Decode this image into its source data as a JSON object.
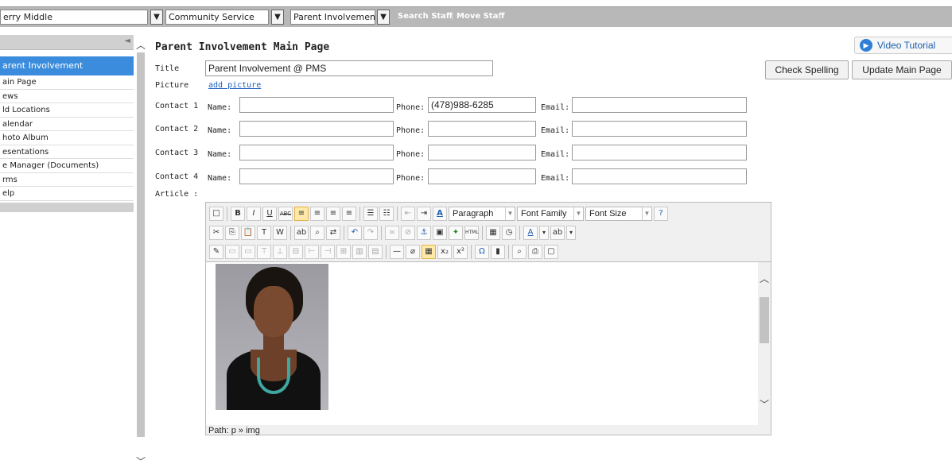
{
  "topbar": {
    "school_select": "erry Middle",
    "section_select": "Community Service",
    "page_select": "Parent Involvement",
    "search_staff": "Search Staff",
    "move_staff": "Move Staff",
    "separator": "|"
  },
  "sidebar": {
    "collapse_glyph": "◄",
    "active": "arent Involvement",
    "items": [
      "ain Page",
      "ews",
      "ld Locations",
      "alendar",
      "hoto Album",
      "esentations",
      "e Manager (Documents)",
      "rms",
      "elp"
    ]
  },
  "main": {
    "title": "Parent Involvement Main Page",
    "video_tutorial": "Video Tutorial",
    "check_spelling": "Check Spelling",
    "update_main_page": "Update Main Page",
    "title_label": "Title",
    "title_value": "Parent Involvement @ PMS",
    "picture_label": "Picture",
    "add_picture": "add picture",
    "name_label": "Name:",
    "phone_label": "Phone:",
    "email_label": "Email:",
    "article_label": "Article :",
    "contacts": [
      {
        "label": "Contact 1",
        "name": "",
        "phone": "(478)988-6285",
        "email": ""
      },
      {
        "label": "Contact 2",
        "name": "",
        "phone": "",
        "email": ""
      },
      {
        "label": "Contact 3",
        "name": "",
        "phone": "",
        "email": ""
      },
      {
        "label": "Contact 4",
        "name": "",
        "phone": "",
        "email": ""
      }
    ]
  },
  "editor": {
    "paragraph": "Paragraph",
    "font_family": "Font Family",
    "font_size": "Font Size",
    "path": "Path: p » img",
    "bold": "B",
    "italic": "I",
    "underline": "U",
    "strike": "ABC",
    "subscript": "x₂",
    "superscript": "x²",
    "omega": "Ω",
    "html": "HTML",
    "hr": "—"
  },
  "colors": {
    "accent": "#3b8cdd",
    "topbar": "#b8b8b8",
    "link": "#1a5fbf"
  }
}
